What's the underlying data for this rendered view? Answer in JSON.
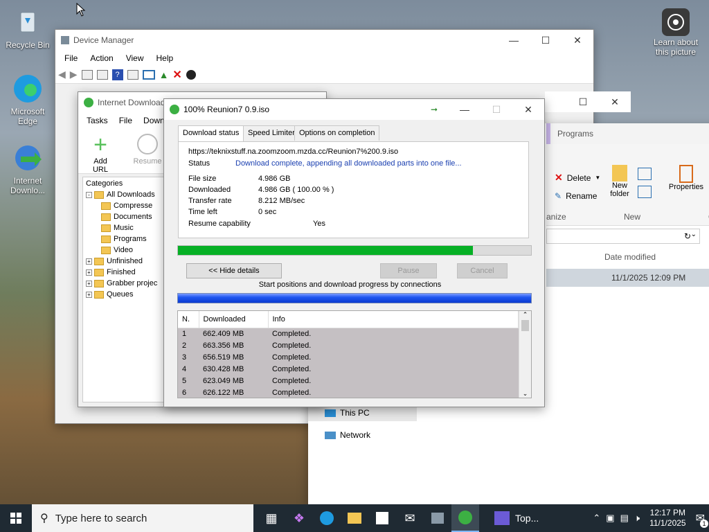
{
  "desktop": {
    "icons": [
      {
        "label": "Recycle Bin"
      },
      {
        "label": "Microsoft Edge"
      },
      {
        "label": "Internet Downlo..."
      }
    ],
    "learn_label": "Learn about this picture"
  },
  "device_manager": {
    "title": "Device Manager",
    "menu": [
      "File",
      "Action",
      "View",
      "Help"
    ]
  },
  "explorer": {
    "programs_label": "Programs",
    "ribbon": {
      "delete": "Delete",
      "rename": "Rename",
      "new_folder": "New folder",
      "properties": "Properties",
      "organize": "anize",
      "new_group": "New",
      "open_group": "Op"
    },
    "columns": {
      "date_modified": "Date modified"
    },
    "row_date": "11/1/2025 12:09 PM",
    "nav": [
      "This PC",
      "Network"
    ]
  },
  "idm_main": {
    "title": "Internet Download",
    "menu": [
      "Tasks",
      "File",
      "Downlo"
    ],
    "toolbar": {
      "add_url": "Add URL",
      "resume": "Resume"
    },
    "categories_label": "Categories",
    "tree": [
      {
        "label": "All Downloads",
        "level": 0,
        "pm": "-"
      },
      {
        "label": "Compresse",
        "level": 1
      },
      {
        "label": "Documents",
        "level": 1
      },
      {
        "label": "Music",
        "level": 1
      },
      {
        "label": "Programs",
        "level": 1
      },
      {
        "label": "Video",
        "level": 1
      },
      {
        "label": "Unfinished",
        "level": 0,
        "pm": "+"
      },
      {
        "label": "Finished",
        "level": 0,
        "pm": "+"
      },
      {
        "label": "Grabber projec",
        "level": 0,
        "pm": "+"
      },
      {
        "label": "Queues",
        "level": 0,
        "pm": "+"
      }
    ]
  },
  "dialog": {
    "title": "100% Reunion7 0.9.iso",
    "tabs": [
      "Download status",
      "Speed Limiter",
      "Options on completion"
    ],
    "url": "https://teknixstuff.na.zoomzoom.mzda.cc/Reunion7%200.9.iso",
    "status_label": "Status",
    "status_value": "Download complete, appending all downloaded parts into one file...",
    "file_size_label": "File size",
    "file_size_value": "4.986  GB",
    "downloaded_label": "Downloaded",
    "downloaded_value": "4.986  GB  ( 100.00 % )",
    "transfer_label": "Transfer rate",
    "transfer_value": "8.212  MB/sec",
    "time_left_label": "Time left",
    "time_left_value": "0 sec",
    "resume_label": "Resume capability",
    "resume_value": "Yes",
    "progress_fraction": 0.835,
    "buttons": {
      "hide_details": "<< Hide details",
      "pause": "Pause",
      "cancel": "Cancel"
    },
    "connections_label": "Start positions and download progress by connections",
    "table_headers": [
      "N.",
      "Downloaded",
      "Info"
    ],
    "connections": [
      {
        "n": "1",
        "downloaded": "662.409  MB",
        "info": "Completed."
      },
      {
        "n": "2",
        "downloaded": "663.356  MB",
        "info": "Completed."
      },
      {
        "n": "3",
        "downloaded": "656.519  MB",
        "info": "Completed."
      },
      {
        "n": "4",
        "downloaded": "630.428  MB",
        "info": "Completed."
      },
      {
        "n": "5",
        "downloaded": "623.049  MB",
        "info": "Completed."
      },
      {
        "n": "6",
        "downloaded": "626.122  MB",
        "info": "Completed."
      }
    ]
  },
  "taskbar": {
    "search_placeholder": "Type here to search",
    "running_label": "Top...",
    "time": "12:17 PM",
    "date": "11/1/2025",
    "notification_count": "1"
  },
  "colors": {
    "progress_green": "#06b025",
    "accent_blue": "#0050ef",
    "status_blue": "#1a3fb0"
  }
}
